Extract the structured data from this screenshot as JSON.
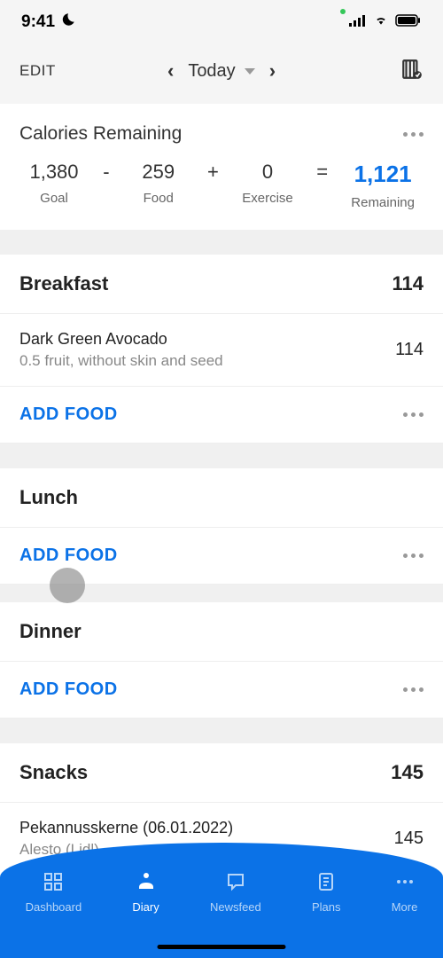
{
  "statusBar": {
    "time": "9:41"
  },
  "header": {
    "editLabel": "EDIT",
    "dateLabel": "Today"
  },
  "calories": {
    "title": "Calories Remaining",
    "goal": {
      "value": "1,380",
      "label": "Goal"
    },
    "food": {
      "value": "259",
      "label": "Food"
    },
    "exercise": {
      "value": "0",
      "label": "Exercise"
    },
    "remaining": {
      "value": "1,121",
      "label": "Remaining"
    },
    "ops": {
      "minus": "-",
      "plus": "+",
      "equals": "="
    }
  },
  "meals": {
    "breakfast": {
      "name": "Breakfast",
      "calories": "114",
      "items": [
        {
          "name": "Dark Green Avocado",
          "detail": "0.5 fruit, without skin and seed",
          "calories": "114"
        }
      ],
      "addLabel": "ADD FOOD"
    },
    "lunch": {
      "name": "Lunch",
      "addLabel": "ADD FOOD"
    },
    "dinner": {
      "name": "Dinner",
      "addLabel": "ADD FOOD"
    },
    "snacks": {
      "name": "Snacks",
      "calories": "145",
      "items": [
        {
          "name": "Pekannusskerne (06.01.2022)",
          "detail": "Alesto (Lidl)",
          "calories": "145"
        }
      ]
    }
  },
  "nav": {
    "dashboard": "Dashboard",
    "diary": "Diary",
    "newsfeed": "Newsfeed",
    "plans": "Plans",
    "more": "More"
  }
}
